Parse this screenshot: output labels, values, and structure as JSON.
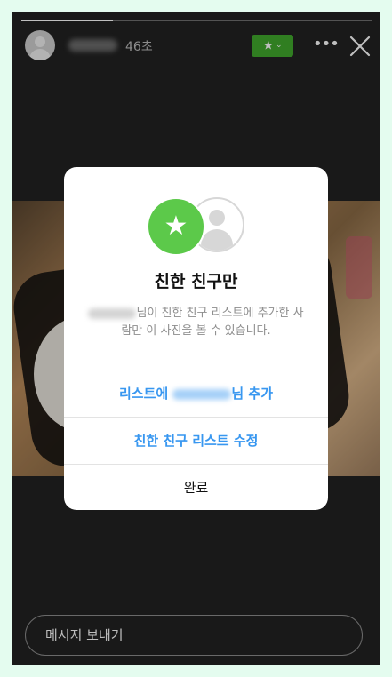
{
  "header": {
    "time_ago": "46초",
    "progress_fraction": 0.26,
    "badge_icon": "star-icon",
    "badge_color": "#41a82c"
  },
  "modal": {
    "title": "친한 친구만",
    "description_part1": "님이 친한 친구 리스트에 추가한 사",
    "description_part2": "람만 이 사진을 볼 수 있습니다.",
    "add_to_list_prefix": "리스트에 ",
    "add_to_list_suffix": "님 추가",
    "edit_list": "친한 친구 리스트 수정",
    "done": "완료",
    "accent_color": "#3897f0",
    "icon_color": "#5cc94a"
  },
  "footer": {
    "message_placeholder": "메시지 보내기"
  }
}
